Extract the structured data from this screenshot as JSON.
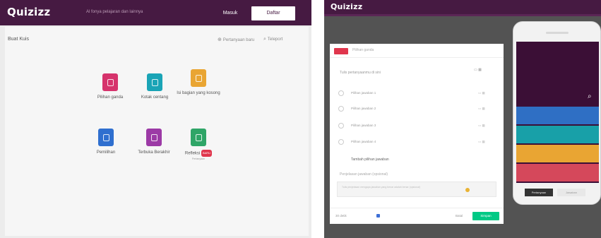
{
  "left": {
    "logo": "Quizizz",
    "search_placeholder": "Al fonya pelajaran dan lainnya",
    "login": "Masuk",
    "signup": "Daftar",
    "create_label": "Buat Kuis",
    "teleport": "Teleport",
    "bank": "Pertanyaan baru",
    "question_types": [
      {
        "label": "Pilihan ganda",
        "color": "#d6336c"
      },
      {
        "label": "Kotak centang",
        "color": "#1aa4b6"
      },
      {
        "label": "Isi bagian yang kosong",
        "color": "#e9a533"
      },
      {
        "label": "Pemilihan",
        "color": "#2f6fcf"
      },
      {
        "label": "Terbuka Berakhir",
        "color": "#9c3aa6"
      },
      {
        "label": "Refleksi",
        "badge": "BARU",
        "sub": "Pertanyaan",
        "color": "#2fa567"
      }
    ]
  },
  "right": {
    "logo": "Quizizz",
    "editor": {
      "type_label": "Pilihan ganda",
      "question_placeholder": "Tulis pertanyaanmu di sini",
      "answers": [
        "Pilihan jawaban 1",
        "Pilihan jawaban 2",
        "Pilihan jawaban 3",
        "Pilihan jawaban 4"
      ],
      "add_option": "Tambah pilihan jawaban",
      "explanation_label": "Penjelasan jawaban (opsional)",
      "explanation_text": "Tulis penjelasan mengapa jawaban yang benar adalah benar (opsional)",
      "timer": "30 detik",
      "cancel": "Batal",
      "save": "Simpan"
    },
    "phone": {
      "options_colors": [
        "#2f6fc4",
        "#18a0a8",
        "#e9a533",
        "#d5485b"
      ],
      "tab_a": "Pertanyaan",
      "tab_b": "Jawaban"
    }
  }
}
